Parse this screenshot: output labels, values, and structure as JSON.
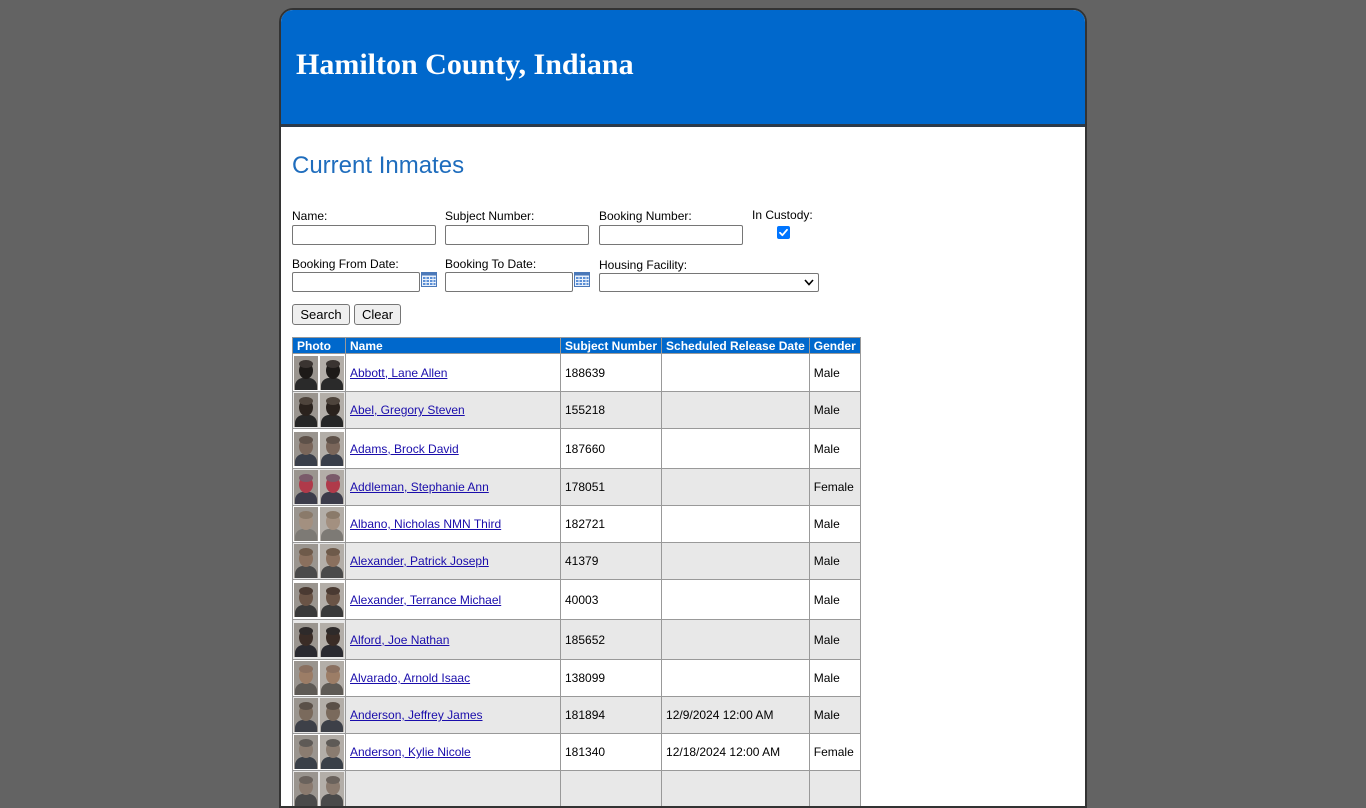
{
  "banner": {
    "title": "Hamilton County, Indiana",
    "background": "#0068cc"
  },
  "page": {
    "heading": "Current Inmates"
  },
  "search": {
    "name_label": "Name:",
    "name_value": "",
    "subject_number_label": "Subject Number:",
    "subject_number_value": "",
    "booking_number_label": "Booking Number:",
    "booking_number_value": "",
    "in_custody_label": "In Custody:",
    "in_custody_checked": true,
    "booking_from_label": "Booking From Date:",
    "booking_from_value": "",
    "booking_to_label": "Booking To Date:",
    "booking_to_value": "",
    "housing_facility_label": "Housing Facility:",
    "housing_facility_selected": "",
    "calendar_icon": "calendar-icon",
    "search_button": "Search",
    "clear_button": "Clear"
  },
  "table": {
    "headers": [
      "Photo",
      "Name",
      "Subject Number",
      "Scheduled Release Date",
      "Gender"
    ],
    "header_color": "#0068cc",
    "alt_row_color": "#e8e8e8",
    "rows": [
      {
        "name": "Abbott, Lane Allen",
        "subject_number": "188639",
        "release_date": "",
        "gender": "Male"
      },
      {
        "name": "Abel, Gregory Steven",
        "subject_number": "155218",
        "release_date": "",
        "gender": "Male"
      },
      {
        "name": "Adams, Brock David",
        "subject_number": "187660",
        "release_date": "",
        "gender": "Male"
      },
      {
        "name": "Addleman, Stephanie Ann",
        "subject_number": "178051",
        "release_date": "",
        "gender": "Female"
      },
      {
        "name": "Albano, Nicholas NMN Third",
        "subject_number": "182721",
        "release_date": "",
        "gender": "Male"
      },
      {
        "name": "Alexander, Patrick Joseph",
        "subject_number": "41379",
        "release_date": "",
        "gender": "Male"
      },
      {
        "name": "Alexander, Terrance Michael",
        "subject_number": "40003",
        "release_date": "",
        "gender": "Male"
      },
      {
        "name": "Alford, Joe Nathan",
        "subject_number": "185652",
        "release_date": "",
        "gender": "Male"
      },
      {
        "name": "Alvarado, Arnold Isaac",
        "subject_number": "138099",
        "release_date": "",
        "gender": "Male"
      },
      {
        "name": "Anderson, Jeffrey James",
        "subject_number": "181894",
        "release_date": "12/9/2024 12:00 AM",
        "gender": "Male"
      },
      {
        "name": "Anderson, Kylie Nicole",
        "subject_number": "181340",
        "release_date": "12/18/2024 12:00 AM",
        "gender": "Female"
      },
      {
        "name": "",
        "subject_number": "",
        "release_date": "",
        "gender": ""
      }
    ]
  }
}
